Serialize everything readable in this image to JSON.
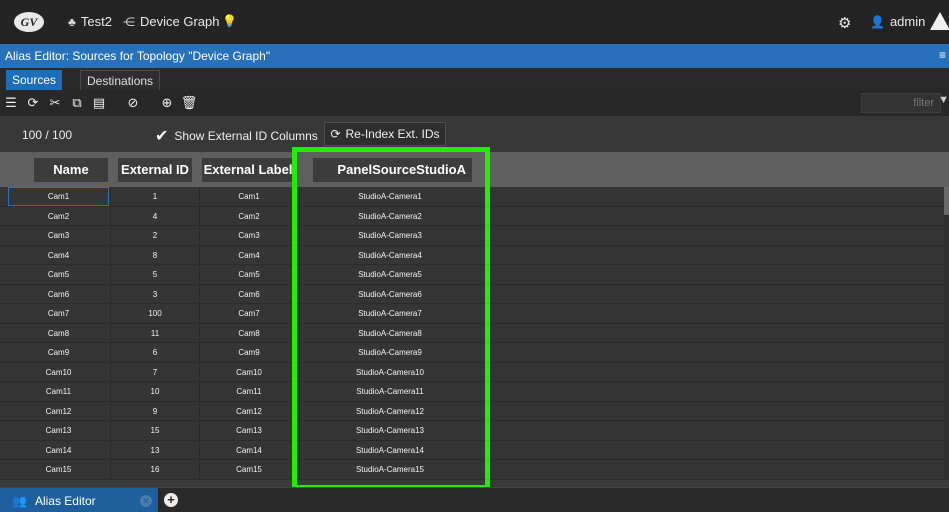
{
  "topbar": {
    "logo_text": "GV",
    "project": "Test2",
    "graph": "Device Graph",
    "user": "admin"
  },
  "title": "Alias Editor: Sources for Topology \"Device Graph\"",
  "tabs": [
    {
      "label": "Sources",
      "active": true
    },
    {
      "label": "Destinations",
      "active": false
    }
  ],
  "toolbar": {
    "icons": [
      "list-icon",
      "refresh-icon",
      "cut-icon",
      "copy-icon",
      "paste-icon",
      "clear-icon",
      "add-icon",
      "delete-icon"
    ],
    "filter_placeholder": "filter"
  },
  "info": {
    "count": "100 / 100",
    "show_external_label": "Show External ID Columns",
    "show_external_checked": true,
    "reindex_label": "Re-Index Ext. IDs"
  },
  "columns": [
    "Name",
    "External ID",
    "External Label",
    "PanelSourceStudioA"
  ],
  "rows": [
    {
      "name": "Cam1",
      "ext_id": "1",
      "ext_label": "Cam1",
      "panel": "StudioA-Camera1"
    },
    {
      "name": "Cam2",
      "ext_id": "4",
      "ext_label": "Cam2",
      "panel": "StudioA-Camera2"
    },
    {
      "name": "Cam3",
      "ext_id": "2",
      "ext_label": "Cam3",
      "panel": "StudioA-Camera3"
    },
    {
      "name": "Cam4",
      "ext_id": "8",
      "ext_label": "Cam4",
      "panel": "StudioA-Camera4"
    },
    {
      "name": "Cam5",
      "ext_id": "5",
      "ext_label": "Cam5",
      "panel": "StudioA-Camera5"
    },
    {
      "name": "Cam6",
      "ext_id": "3",
      "ext_label": "Cam6",
      "panel": "StudioA-Camera6"
    },
    {
      "name": "Cam7",
      "ext_id": "100",
      "ext_label": "Cam7",
      "panel": "StudioA-Camera7"
    },
    {
      "name": "Cam8",
      "ext_id": "11",
      "ext_label": "Cam8",
      "panel": "StudioA-Camera8"
    },
    {
      "name": "Cam9",
      "ext_id": "6",
      "ext_label": "Cam9",
      "panel": "StudioA-Camera9"
    },
    {
      "name": "Cam10",
      "ext_id": "7",
      "ext_label": "Cam10",
      "panel": "StudioA-Camera10"
    },
    {
      "name": "Cam11",
      "ext_id": "10",
      "ext_label": "Cam11",
      "panel": "StudioA-Camera11"
    },
    {
      "name": "Cam12",
      "ext_id": "9",
      "ext_label": "Cam12",
      "panel": "StudioA-Camera12"
    },
    {
      "name": "Cam13",
      "ext_id": "15",
      "ext_label": "Cam13",
      "panel": "StudioA-Camera13"
    },
    {
      "name": "Cam14",
      "ext_id": "13",
      "ext_label": "Cam14",
      "panel": "StudioA-Camera14"
    },
    {
      "name": "Cam15",
      "ext_id": "16",
      "ext_label": "Cam15",
      "panel": "StudioA-Camera15"
    }
  ],
  "bottom": {
    "tab_label": "Alias Editor"
  },
  "colors": {
    "accent": "#2871b8",
    "highlight": "#22ee00"
  }
}
